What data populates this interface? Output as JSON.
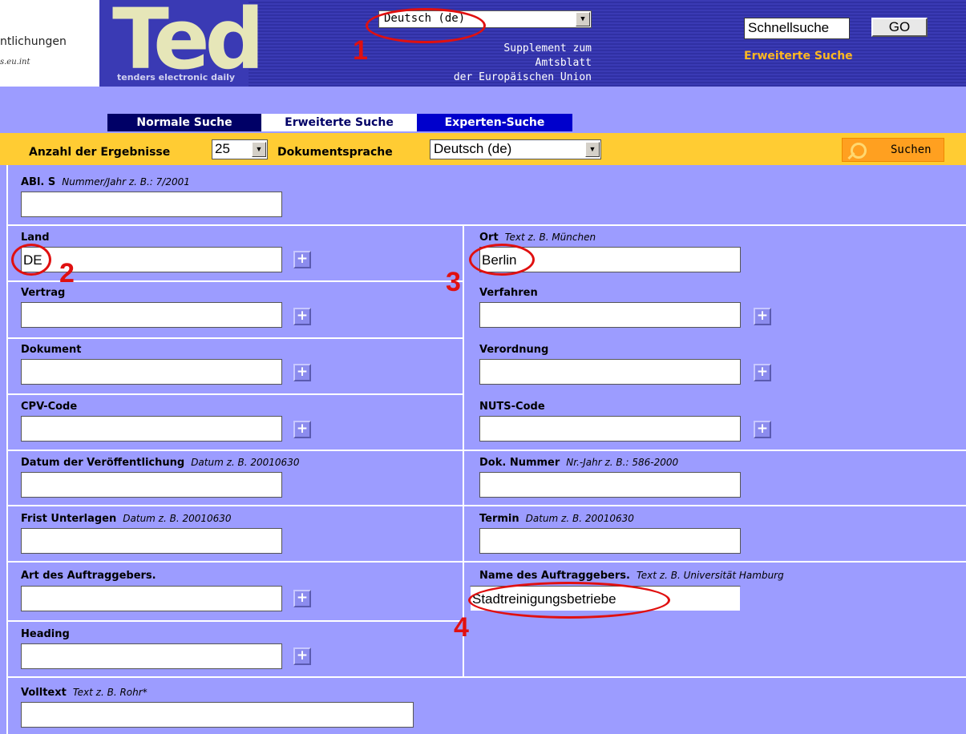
{
  "header": {
    "logo_left_text": "ntlichungen",
    "logo_left_url": "s.eu.int",
    "ted_word": "Ted",
    "ted_tagline": "tenders electronic daily",
    "language_select": {
      "value": "Deutsch (de)"
    },
    "supplement_lines": [
      "Supplement zum",
      "Amtsblatt",
      "der Europäischen Union"
    ],
    "quick_search": {
      "value": "Schnellsuche",
      "button": "GO"
    },
    "advanced_link": "Erweiterte Suche"
  },
  "tabs": [
    {
      "label": "Normale Suche"
    },
    {
      "label": "Erweiterte Suche"
    },
    {
      "label": "Experten-Suche"
    }
  ],
  "toolbar": {
    "results_label": "Anzahl der Ergebnisse",
    "results_value": "25",
    "doclang_label": "Dokumentsprache",
    "doclang_value": "Deutsch (de)",
    "search_button": "Suchen"
  },
  "form": {
    "abl": {
      "label": "ABl. S",
      "hint": "Nummer/Jahr z. B.: 7/2001",
      "value": ""
    },
    "land": {
      "label": "Land",
      "value": "DE"
    },
    "ort": {
      "label": "Ort",
      "hint": "Text z. B. München",
      "value": "Berlin"
    },
    "vertrag": {
      "label": "Vertrag",
      "value": ""
    },
    "verfahren": {
      "label": "Verfahren",
      "value": ""
    },
    "dokument": {
      "label": "Dokument",
      "value": ""
    },
    "verordnung": {
      "label": "Verordnung",
      "value": ""
    },
    "cpv": {
      "label": "CPV-Code",
      "value": ""
    },
    "nuts": {
      "label": "NUTS-Code",
      "value": ""
    },
    "datum": {
      "label": "Datum der Veröffentlichung",
      "hint": "Datum z. B. 20010630",
      "value": ""
    },
    "doknr": {
      "label": "Dok. Nummer",
      "hint": "Nr.-Jahr z. B.: 586-2000",
      "value": ""
    },
    "frist": {
      "label": "Frist Unterlagen",
      "hint": "Datum z. B. 20010630",
      "value": ""
    },
    "termin": {
      "label": "Termin",
      "hint": "Datum z. B. 20010630",
      "value": ""
    },
    "art": {
      "label": "Art des Auftraggebers.",
      "value": ""
    },
    "name": {
      "label": "Name des Auftraggebers.",
      "hint": "Text z. B. Universität Hamburg",
      "value": "Stadtreinigungsbetriebe"
    },
    "heading": {
      "label": "Heading",
      "value": ""
    },
    "volltext": {
      "label": "Volltext",
      "hint": "Text z. B. Rohr*",
      "value": ""
    },
    "plus_symbol": "+"
  },
  "annotations": {
    "n1": "1",
    "n2": "2",
    "n3": "3",
    "n4": "4"
  },
  "colors": {
    "annotation": "#e01010",
    "header_bg": "#3333aa",
    "form_bg": "#9c9cff",
    "toolbar_bg": "#ffcc33"
  }
}
